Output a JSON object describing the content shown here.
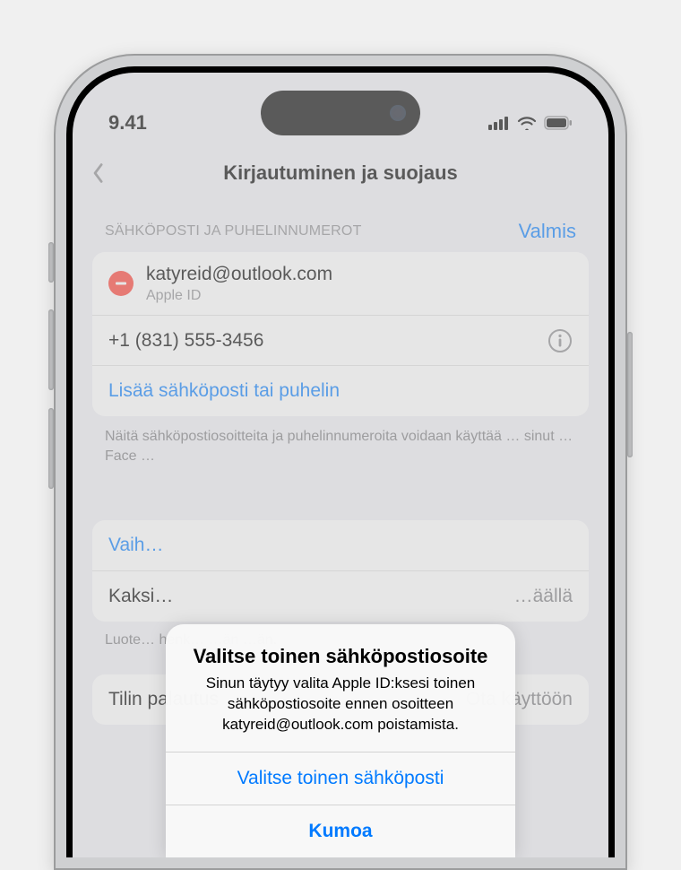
{
  "status": {
    "time": "9.41"
  },
  "nav": {
    "title": "Kirjautuminen ja suojaus"
  },
  "section": {
    "header": "SÄHKÖPOSTI JA PUHELINNUMEROT",
    "done": "Valmis",
    "email": "katyreid@outlook.com",
    "email_sub": "Apple ID",
    "phone": "+1 (831) 555-3456",
    "add": "Lisää sähköposti tai puhelin",
    "footer": "Näitä sähköpostiosoitteita ja puhelinnumeroita voidaan käyttää … sinut … Face …"
  },
  "group2": {
    "change": "Vaih…",
    "twofa_label": "Kaksi…",
    "twofa_value": "…äällä",
    "footer": "Luote… henk… …än …än."
  },
  "group3": {
    "recovery_label": "Tilin palautus",
    "recovery_value": "Ota käyttöön"
  },
  "alert": {
    "title": "Valitse toinen sähköpostiosoite",
    "message": "Sinun täytyy valita Apple ID:ksesi toinen sähköpostiosoite ennen osoitteen katyreid@outlook.com poistamista.",
    "choose": "Valitse toinen sähköposti",
    "cancel": "Kumoa"
  }
}
